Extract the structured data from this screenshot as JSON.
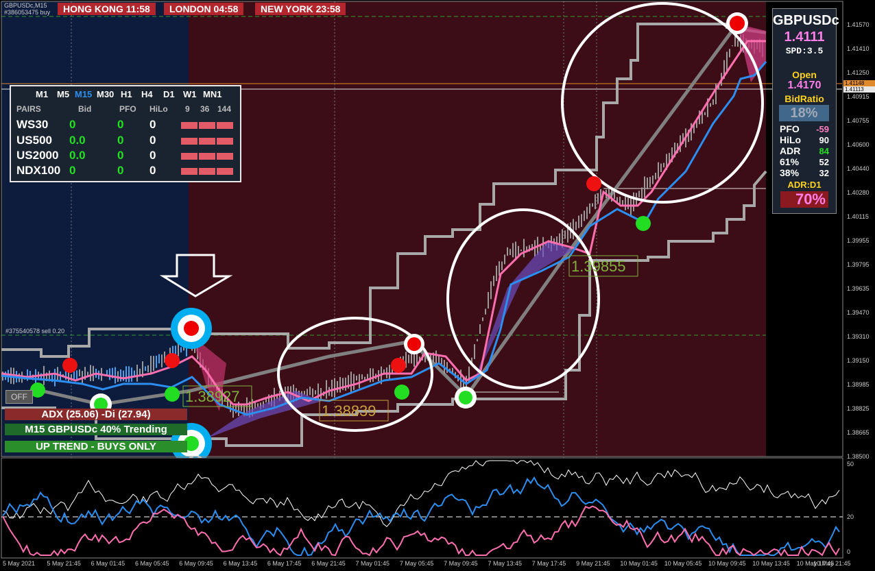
{
  "window": {
    "symbol_title": "GBPUSDc,M15",
    "order_id_top": "#386053475 buy",
    "order_id_sell": "#375540578 sell 0.20"
  },
  "clocks": [
    {
      "label": "HONG KONG 11:58"
    },
    {
      "label": "LONDON  04:58"
    },
    {
      "label": "NEW YORK 23:58"
    }
  ],
  "timeframes": {
    "items": [
      "M1",
      "M5",
      "M15",
      "M30",
      "H1",
      "H4",
      "D1",
      "W1",
      "MN1"
    ],
    "active": "M15",
    "headers": [
      "PAIRS",
      "Bid",
      "PFO",
      "HiLo",
      "9",
      "36",
      "144"
    ],
    "rows": [
      {
        "pair": "WS30",
        "bid": "0",
        "pfo": "0",
        "hilo": "0"
      },
      {
        "pair": "US500",
        "bid": "0.0",
        "pfo": "0",
        "hilo": "0"
      },
      {
        "pair": "US2000",
        "bid": "0.0",
        "pfo": "0",
        "hilo": "0"
      },
      {
        "pair": "NDX100",
        "bid": "0",
        "pfo": "0",
        "hilo": "0"
      }
    ]
  },
  "info_panel": {
    "symbol": "GBPUSDc",
    "price": "1.4111",
    "spread": "SPD:3.5",
    "open_label": "Open",
    "open_value": "1.4170",
    "bid_ratio_label": "BidRatio",
    "bid_ratio_value": "18%",
    "stats": [
      {
        "label": "PFO",
        "value": "-59",
        "color": "#ff7fc0"
      },
      {
        "label": "HiLo",
        "value": "90",
        "color": "#ffffff"
      },
      {
        "label": "ADR",
        "value": "84",
        "color": "#22e022"
      },
      {
        "label": "61%",
        "value": "52",
        "color": "#ffffff"
      },
      {
        "label": "38%",
        "value": "32",
        "color": "#ffffff"
      }
    ],
    "adr_label": "ADR:D1",
    "adr_value": "70%"
  },
  "status_boxes": {
    "off_button": "OFF",
    "adx": "ADX (25.06)  -Di (27.94)",
    "trend_strength": "M15 GBPUSDc 40% Trending",
    "direction": "UP TREND - BUYS ONLY"
  },
  "chart_labels": [
    {
      "text": "1.38927",
      "color": "#7db33c"
    },
    {
      "text": "1.38839",
      "color": "#c8a23c"
    },
    {
      "text": "1.39855",
      "color": "#7db33c"
    }
  ],
  "price_axis": [
    "1.41570",
    "1.41410",
    "1.41250",
    "1.40915",
    "1.40755",
    "1.40600",
    "1.40440",
    "1.40280",
    "1.40115",
    "1.39955",
    "1.39795",
    "1.39635",
    "1.39470",
    "1.39310",
    "1.39150",
    "1.38985",
    "1.38825",
    "1.38665",
    "1.38500"
  ],
  "price_tags": [
    "1.41148",
    "1.41113"
  ],
  "osc_axis": [
    "50",
    "20",
    "0"
  ],
  "time_axis": [
    "5 May 2021",
    "5 May 21:45",
    "6 May 01:45",
    "6 May 05:45",
    "6 May 09:45",
    "6 May 13:45",
    "6 May 17:45",
    "6 May 21:45",
    "7 May 01:45",
    "7 May 05:45",
    "7 May 09:45",
    "7 May 13:45",
    "7 May 17:45",
    "9 May 21:45",
    "10 May 01:45",
    "10 May 05:45",
    "10 May 09:45",
    "10 May 13:45",
    "10 May 17:45",
    "10 May 21:45"
  ],
  "colors": {
    "asia_session": "#0d1b3d",
    "ny_session": "#3d0d17",
    "ma_blue": "#2b8ef0",
    "ma_pink": "#ff6fb0",
    "band_gray": "#a0a0a0",
    "buy_dot": "#22dd22",
    "sell_dot": "#ff1010"
  }
}
